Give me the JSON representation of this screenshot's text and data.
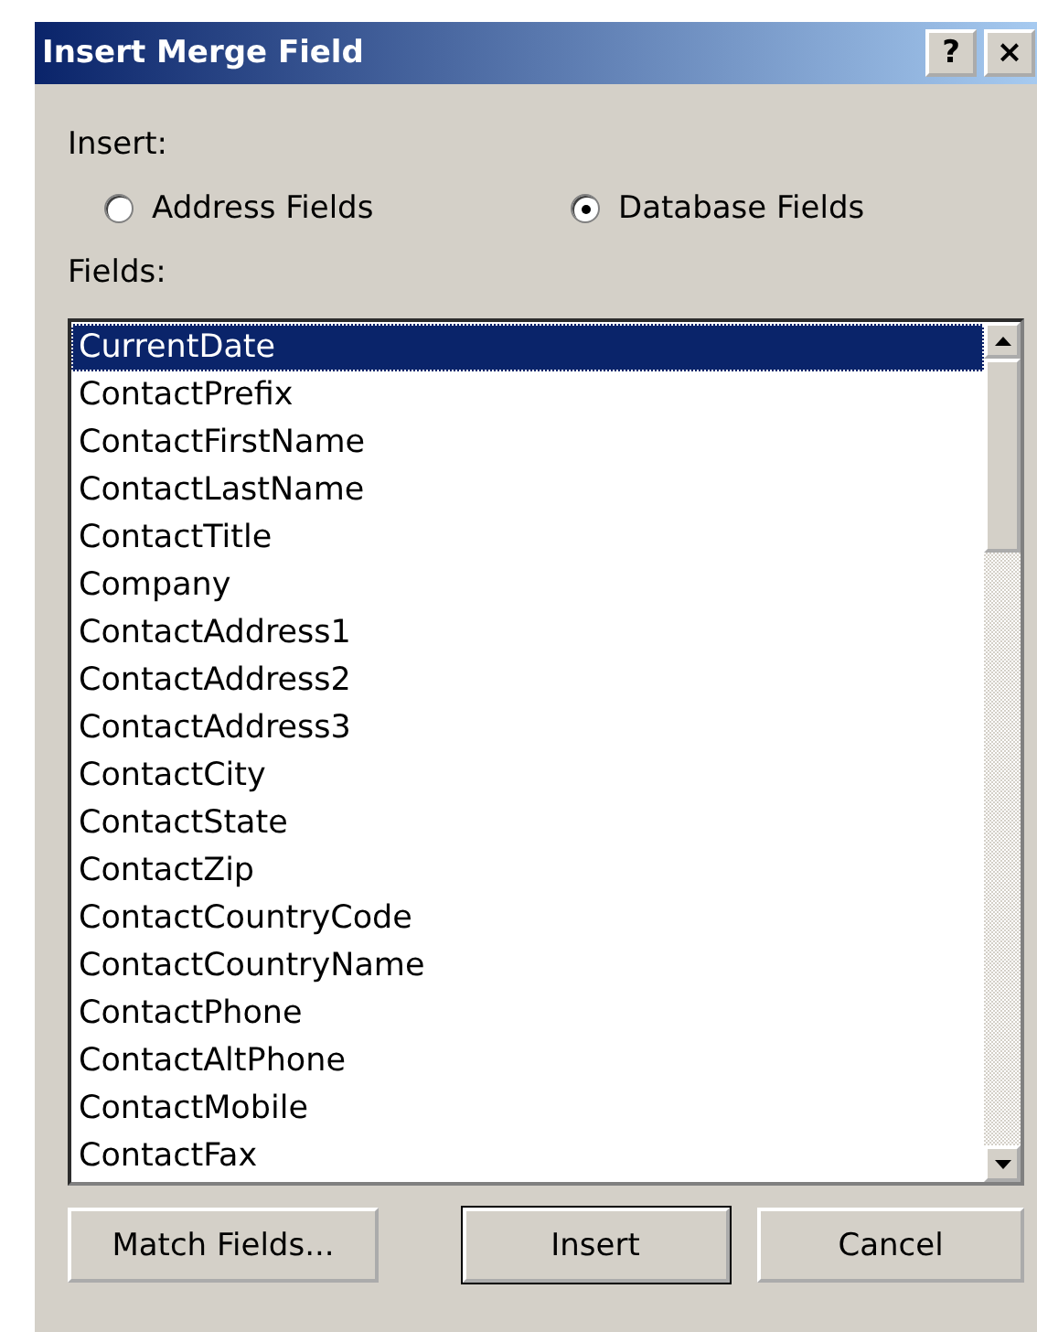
{
  "window": {
    "title": "Insert Merge Field",
    "title_buttons": [
      "?",
      "×"
    ]
  },
  "insert_group": {
    "label": "Insert:",
    "options": [
      {
        "label": "Address Fields",
        "selected": false
      },
      {
        "label": "Database Fields",
        "selected": true
      }
    ]
  },
  "fields": {
    "label": "Fields:",
    "items": [
      {
        "label": "CurrentDate",
        "selected": true
      },
      {
        "label": "ContactPrefix",
        "selected": false
      },
      {
        "label": "ContactFirstName",
        "selected": false
      },
      {
        "label": "ContactLastName",
        "selected": false
      },
      {
        "label": "ContactTitle",
        "selected": false
      },
      {
        "label": "Company",
        "selected": false
      },
      {
        "label": "ContactAddress1",
        "selected": false
      },
      {
        "label": "ContactAddress2",
        "selected": false
      },
      {
        "label": "ContactAddress3",
        "selected": false
      },
      {
        "label": "ContactCity",
        "selected": false
      },
      {
        "label": "ContactState",
        "selected": false
      },
      {
        "label": "ContactZip",
        "selected": false
      },
      {
        "label": "ContactCountryCode",
        "selected": false
      },
      {
        "label": "ContactCountryName",
        "selected": false
      },
      {
        "label": "ContactPhone",
        "selected": false
      },
      {
        "label": "ContactAltPhone",
        "selected": false
      },
      {
        "label": "ContactMobile",
        "selected": false
      },
      {
        "label": "ContactFax",
        "selected": false
      }
    ]
  },
  "buttons": [
    {
      "label": "Match Fields...",
      "default": false
    },
    {
      "label": "Insert",
      "default": true
    },
    {
      "label": "Cancel",
      "default": false
    }
  ]
}
